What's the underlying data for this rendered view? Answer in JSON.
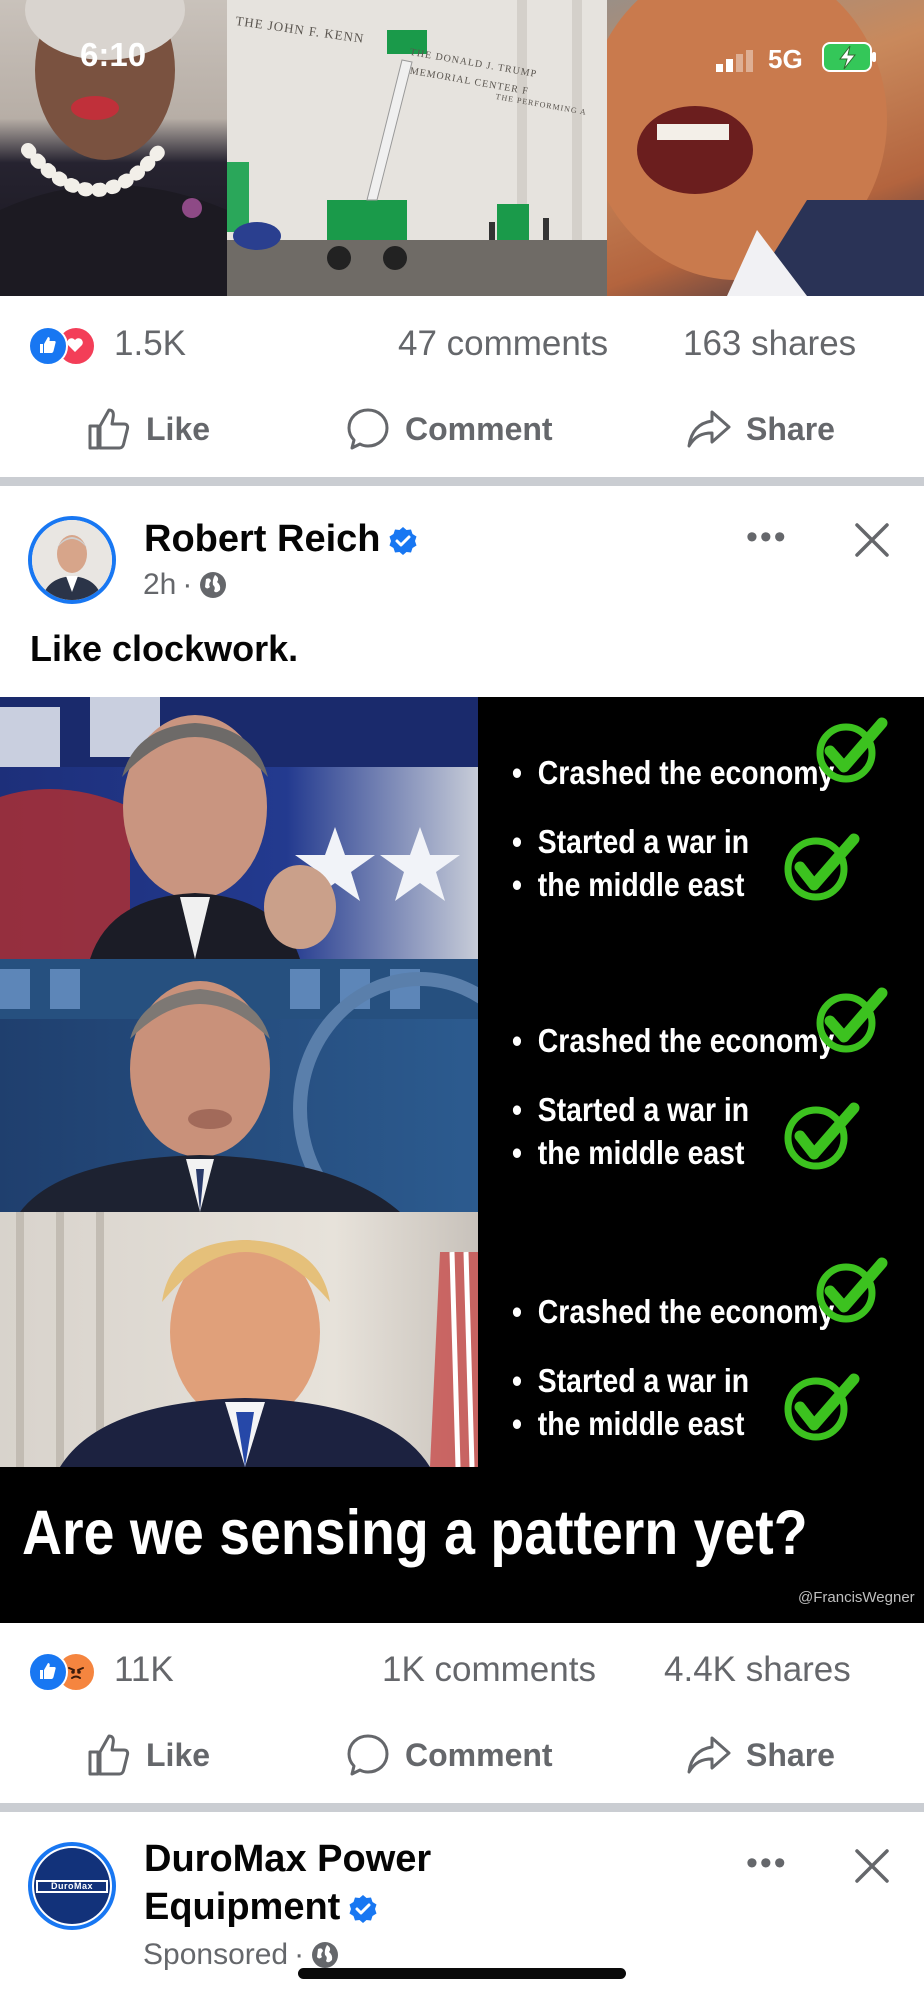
{
  "status_bar": {
    "time": "6:10",
    "network": "5G"
  },
  "previous_post": {
    "building_text_1": "THE JOHN F. KENN",
    "building_text_2": "THE DONALD J. TRUMP",
    "building_text_3": "MEMORIAL CENTER F",
    "building_text_4": "THE PERFORMING A",
    "reaction_count": "1.5K",
    "comments": "47 comments",
    "shares": "163 shares",
    "actions": {
      "like": "Like",
      "comment": "Comment",
      "share": "Share"
    }
  },
  "post": {
    "author": "Robert Reich",
    "time": "2h",
    "text": "Like clockwork.",
    "meme": {
      "bullets": [
        [
          "Crashed the economy",
          "Started a war in",
          "the middle east"
        ],
        [
          "Crashed the economy",
          "Started a war in",
          "the middle east"
        ],
        [
          "Crashed the economy",
          "Started a war in",
          "the middle east"
        ]
      ],
      "caption": "Are we sensing a pattern yet?",
      "credit": "@FrancisWegner"
    },
    "reaction_count": "11K",
    "comments": "1K comments",
    "shares": "4.4K shares",
    "actions": {
      "like": "Like",
      "comment": "Comment",
      "share": "Share"
    }
  },
  "sponsored_post": {
    "author_line1": "DuroMax Power",
    "author_line2": "Equipment",
    "logo_text": "DuroMax",
    "label": "Sponsored"
  },
  "colors": {
    "facebook_blue": "#1877f2",
    "secondary_text": "#65676b",
    "check_green": "#3cc21f"
  }
}
